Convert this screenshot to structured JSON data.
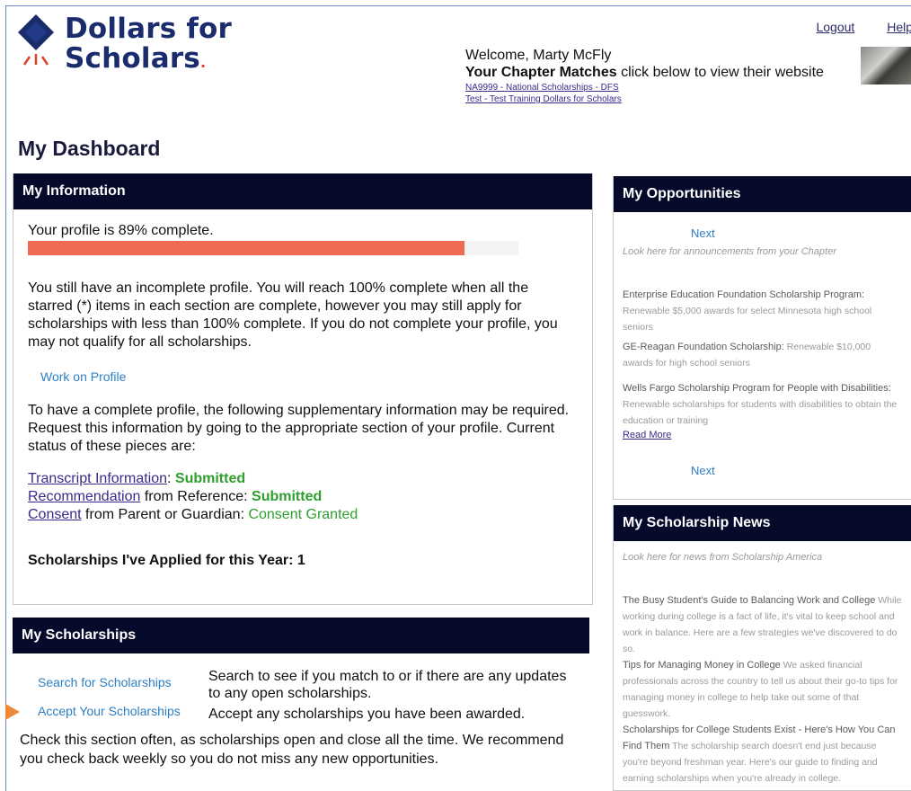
{
  "brand": {
    "name_line1": "Dollars for",
    "name_line2": "Scholars",
    "trademark": ".",
    "colors": {
      "navy": "#1a2c6c",
      "red": "#e0402a",
      "header_bar": "#05092a",
      "progress": "#ef6a50",
      "success": "#2e9e2e",
      "link_blue": "#2d7fc2"
    }
  },
  "top_links": {
    "logout": "Logout",
    "help": "Help"
  },
  "welcome": {
    "greeting": "Welcome, Marty McFly",
    "chapter_heading": "Your Chapter Matches",
    "chapter_instruction": " click below to view their website",
    "chapters": [
      "NA9999 - National Scholarships - DFS",
      "Test - Test Training Dollars for Scholars"
    ]
  },
  "page_title": "My Dashboard",
  "my_information": {
    "heading": "My Information",
    "profile_status": "Your profile is 89% complete.",
    "profile_percent": 89,
    "incomplete_message": "You still have an incomplete profile. You will reach 100% complete when all the starred (*) items in each section are complete, however you may still apply for scholarships with less than 100% complete. If you do not complete your profile, you may not qualify for all scholarships.",
    "work_on_profile": "Work on Profile",
    "supplementary_message": "To have a complete profile, the following supplementary information may be required. Request this information by going to the appropriate section of your profile. Current status of these pieces are:",
    "status_items": [
      {
        "link": "Transcript Information",
        "mid": ": ",
        "status": "Submitted"
      },
      {
        "link": "Recommendation",
        "mid": " from Reference: ",
        "status": "Submitted"
      },
      {
        "link": "Consent",
        "mid": " from Parent or Guardian: ",
        "status": "Consent Granted"
      }
    ],
    "applied_this_year": "Scholarships I've Applied for this Year: 1"
  },
  "my_scholarships": {
    "heading": "My Scholarships",
    "search_link": "Search for Scholarships",
    "search_desc": "Search to see if you match to or if there are any updates to any open scholarships.",
    "accept_link": "Accept Your Scholarships",
    "accept_desc": "Accept any scholarships you have been awarded.",
    "check_message": "Check this section often, as scholarships open and close all the time. We recommend you check back weekly so you do not miss any new opportunities."
  },
  "my_opportunities": {
    "heading": "My Opportunities",
    "next_top": "Next",
    "prompt": "Look here for announcements from your Chapter",
    "items": [
      {
        "title": "Enterprise Education Foundation Scholarship Program:",
        "desc": " Renewable $5,000 awards for select Minnesota high school seniors"
      },
      {
        "title": "GE-Reagan Foundation Scholarship:",
        "desc": " Renewable $10,000 awards for high school seniors"
      },
      {
        "title": "Wells Fargo Scholarship Program for People with Disabilities:",
        "desc": " Renewable scholarships for students with disabilities to obtain the education or training"
      }
    ],
    "read_more": "Read More",
    "next_bottom": "Next"
  },
  "my_scholarship_news": {
    "heading": "My Scholarship News",
    "prompt": "Look here for news from Scholarship America",
    "items": [
      {
        "title": "The Busy Student's Guide to Balancing Work and College",
        "desc": " While working during college is a fact of life, it's vital to keep school and work in balance. Here are a few strategies we've discovered to do so."
      },
      {
        "title": "Tips for Managing Money in College",
        "desc": " We asked financial professionals across the country to tell us about their go-to tips for managing money in college to help take out some of that guesswork."
      },
      {
        "title": "Scholarships for College Students Exist - Here's How You Can Find Them",
        "desc": " The scholarship search doesn't end just because you're beyond freshman year. Here's our guide to finding and earning scholarships when you're already in college."
      }
    ]
  }
}
